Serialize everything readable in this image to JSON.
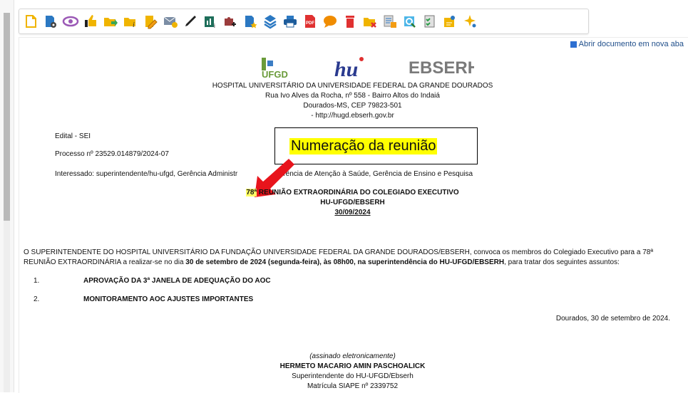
{
  "toolbar": {
    "icons": [
      "new-document-icon",
      "process-settings-icon",
      "view-icon",
      "thumbs-up-icon",
      "forward-icon",
      "folder-info-icon",
      "edit-note-icon",
      "send-mail-icon",
      "signature-pen-icon",
      "process-stats-icon",
      "plugin-add-icon",
      "document-star-icon",
      "layers-icon",
      "print-icon",
      "pdf-icon",
      "comment-icon",
      "delete-icon",
      "folder-remove-icon",
      "document-lookup-icon",
      "search-doc-icon",
      "checklist-icon",
      "user-doc-icon",
      "sparkle-icon"
    ]
  },
  "viewer": {
    "open_new_tab": "Abrir documento em nova aba"
  },
  "header": {
    "logos": {
      "ufgd": "UFGD",
      "hu": "hu",
      "ebserh": "EBSERH"
    },
    "lines": [
      "HOSPITAL UNIVERSITÁRIO DA UNIVERSIDADE FEDERAL DA GRANDE DOURADOS",
      "Rua Ivo Alves da Rocha, nº 558 - Bairro Altos do Indaiá",
      "Dourados-MS, CEP 79823-501",
      "- http://hugd.ebserh.gov.br"
    ]
  },
  "meta": {
    "type": "Edital - SEI",
    "process": "Processo nº 23529.014879/2024-07",
    "interested_a": "Interessado: superintendente/hu-ufgd, Gerência Administr",
    "interested_b": "Gerência de Atenção à Saúde, Gerência de Ensino e Pesquisa"
  },
  "callout": {
    "text": "Numeração da reunião"
  },
  "title": {
    "number": "78ª",
    "line1": "REUNIÃO EXTRAORDINÁRIA DO COLEGIADO EXECUTIVO",
    "line2": "HU-UFGD/EBSERH",
    "date": "30/09/2024"
  },
  "body": {
    "p_a": "O SUPERINTENDENTE DO HOSPITAL UNIVERSITÁRIO DA FUNDAÇÃO UNIVERSIDADE FEDERAL DA GRANDE DOURADOS/EBSERH, convoca os membros do Colegiado Executivo para a 78ª",
    "p_b1": "REUNIÃO EXTRAORDINÁRIA a realizar-se no dia ",
    "p_b2": "30 de setembro de 2024 (segunda-feira), às 08h00, na superintendência do HU-UFGD/EBSERH",
    "p_b3": ", para tratar dos seguintes assuntos:",
    "items": [
      {
        "num": "1.",
        "text": "APROVAÇÃO DA 3ª JANELA DE ADEQUAÇÃO DO AOC"
      },
      {
        "num": "2.",
        "text": "MONITORAMENTO AOC AJUSTES IMPORTANTES"
      }
    ],
    "place_date": "Dourados, 30 de setembro de 2024."
  },
  "signature": {
    "signed": "(assinado eletronicamente)",
    "name": "HERMETO MACARIO AMIN PASCHOALICK",
    "role": "Superintendente do HU-UFGD/Ebserh",
    "siape": "Matrícula SIAPE nº 2339752"
  }
}
